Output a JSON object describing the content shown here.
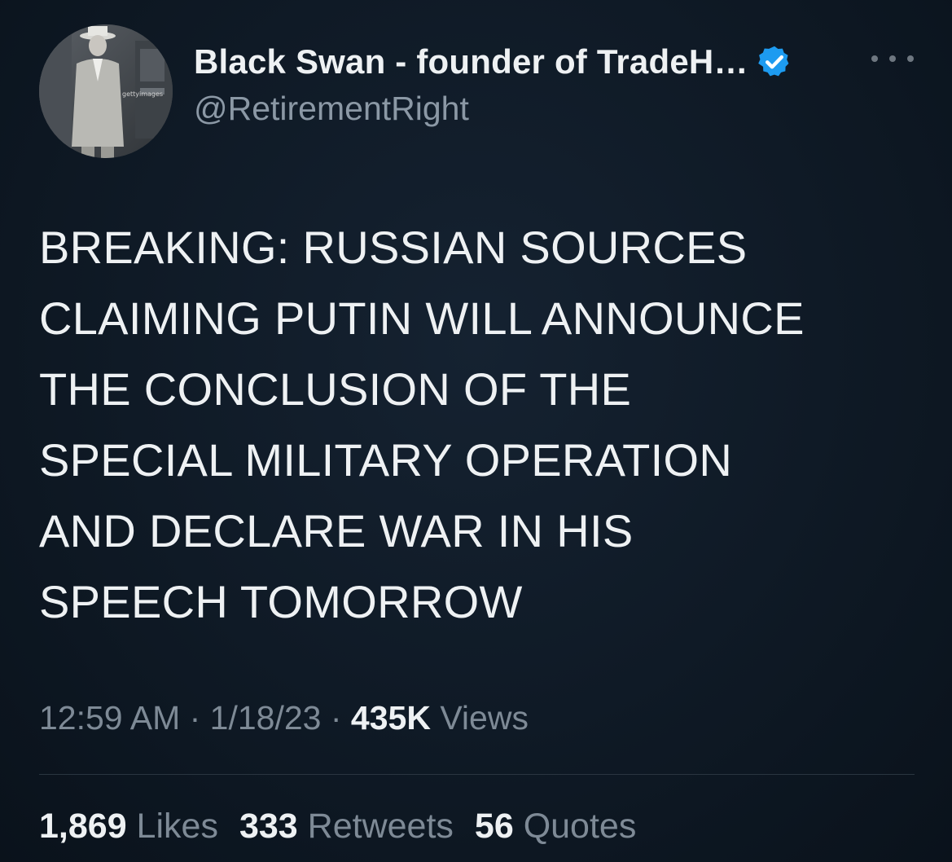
{
  "author": {
    "display_name": "Black Swan - founder of TradeH…",
    "handle": "@RetirementRight",
    "avatar_watermark": "gettyimages"
  },
  "tweet": {
    "lines": [
      "BREAKING: RUSSIAN SOURCES",
      "CLAIMING PUTIN WILL ANNOUNCE",
      "THE CONCLUSION OF THE",
      "SPECIAL MILITARY OPERATION",
      "AND DECLARE WAR IN HIS",
      "SPEECH TOMORROW"
    ]
  },
  "meta": {
    "time": "12:59 AM",
    "sep1": " · ",
    "date": "1/18/23",
    "sep2": " · ",
    "views_count": "435K",
    "views_label": " Views"
  },
  "stats": {
    "likes_count": "1,869",
    "likes_label": " Likes",
    "retweets_count": "333",
    "retweets_label": " Retweets",
    "quotes_count": "56",
    "quotes_label": " Quotes"
  },
  "colors": {
    "background": "#0e1621",
    "text": "#eef1f3",
    "secondary": "#7e8a96",
    "verified": "#1d9bf0"
  },
  "icons": {
    "verified": "verified-badge-icon",
    "more": "more-dots-icon"
  }
}
